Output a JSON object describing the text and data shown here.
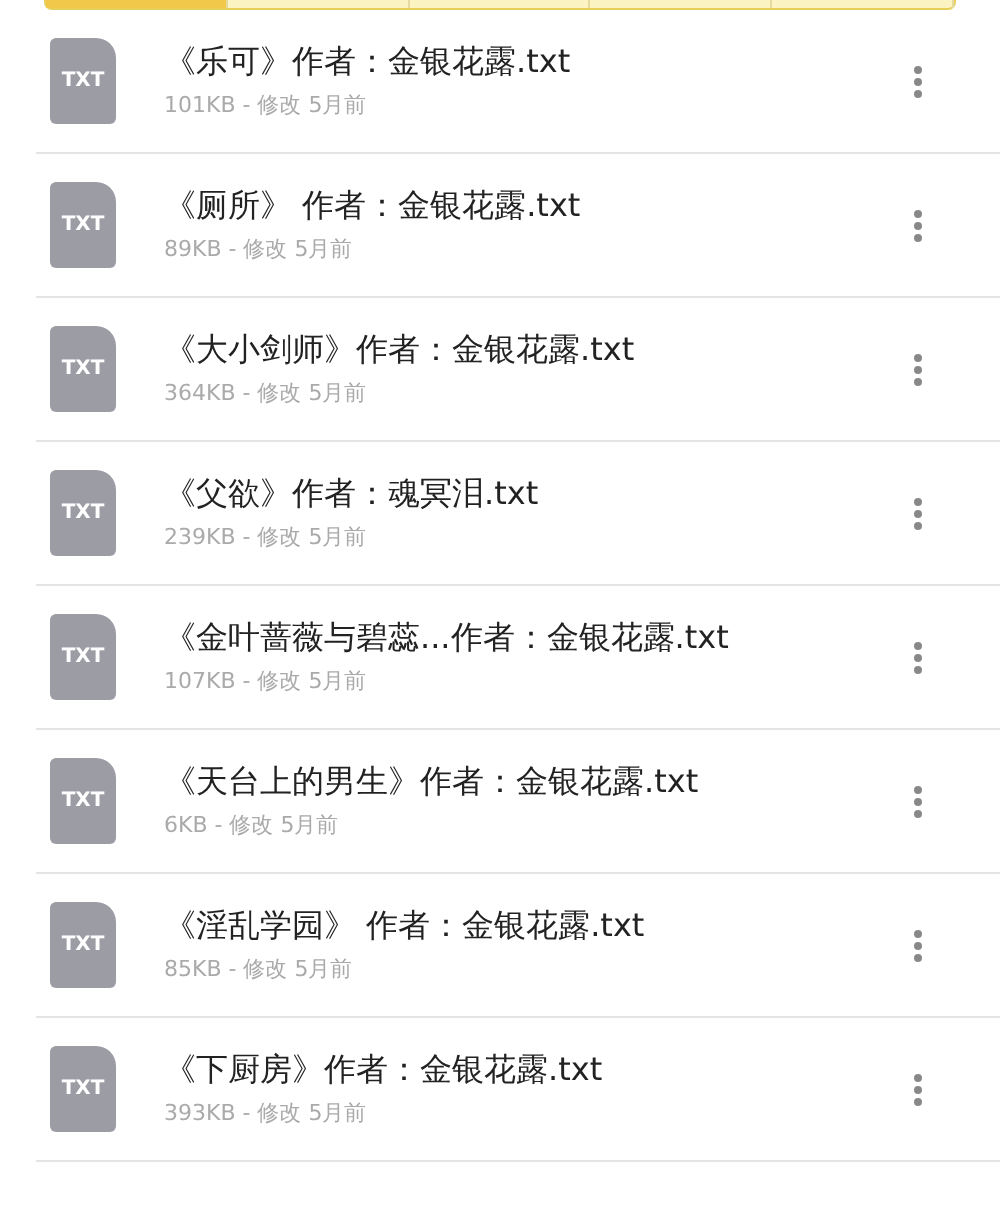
{
  "tab_strip": [
    {
      "selected": true
    },
    {
      "selected": false
    },
    {
      "selected": false
    },
    {
      "selected": false
    },
    {
      "selected": false
    }
  ],
  "files": [
    {
      "icon_label": "TXT",
      "name": "《乐可》作者：金银花露.txt",
      "meta": "101KB - 修改 5月前"
    },
    {
      "icon_label": "TXT",
      "name": "《厕所》 作者：金银花露.txt",
      "meta": "89KB - 修改 5月前"
    },
    {
      "icon_label": "TXT",
      "name": "《大小剑师》作者：金银花露.txt",
      "meta": "364KB - 修改 5月前"
    },
    {
      "icon_label": "TXT",
      "name": "《父欲》作者：魂冥泪.txt",
      "meta": "239KB - 修改 5月前"
    },
    {
      "icon_label": "TXT",
      "name": "《金叶蔷薇与碧蕊...作者：金银花露.txt",
      "meta": "107KB - 修改 5月前"
    },
    {
      "icon_label": "TXT",
      "name": "《天台上的男生》作者：金银花露.txt",
      "meta": "6KB - 修改 5月前"
    },
    {
      "icon_label": "TXT",
      "name": "《淫乱学园》 作者：金银花露.txt",
      "meta": "85KB - 修改 5月前"
    },
    {
      "icon_label": "TXT",
      "name": "《下厨房》作者：金银花露.txt",
      "meta": "393KB - 修改 5月前"
    }
  ]
}
